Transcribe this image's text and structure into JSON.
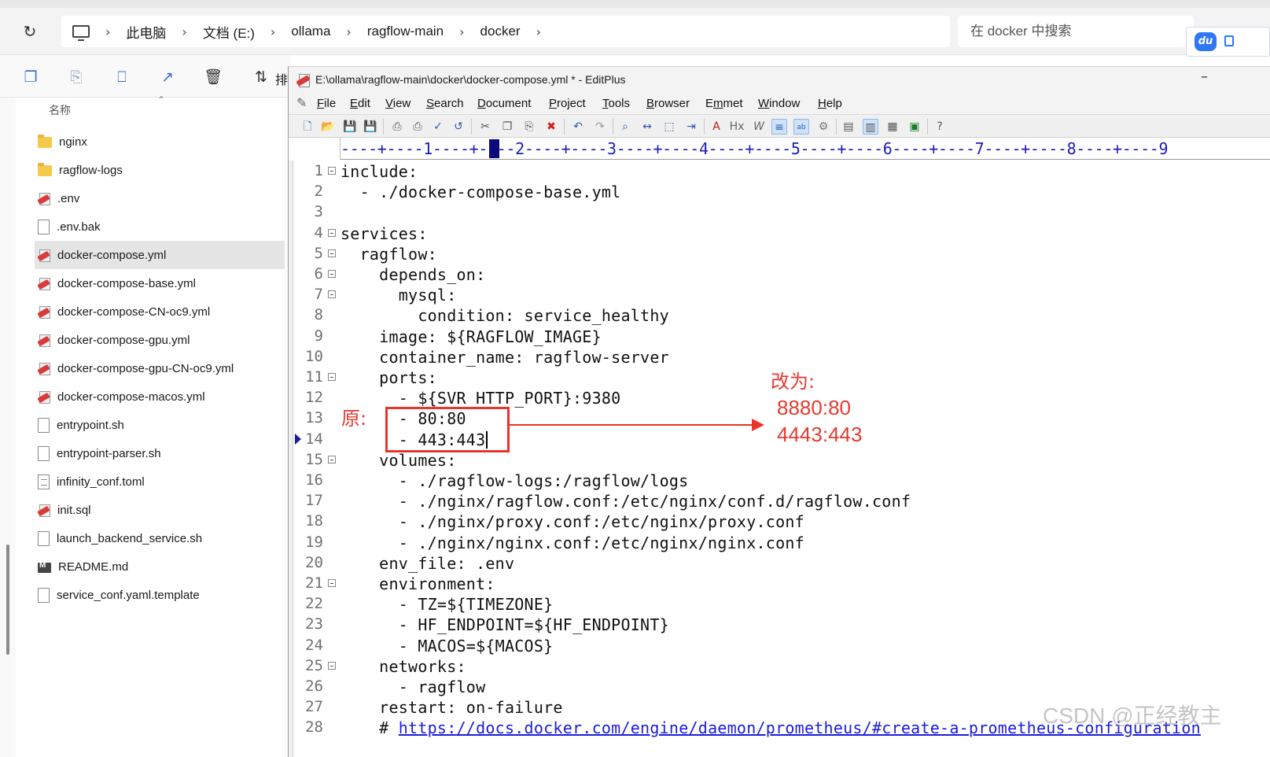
{
  "explorer": {
    "breadcrumb": [
      "此电脑",
      "文档 (E:)",
      "ollama",
      "ragflow-main",
      "docker"
    ],
    "search_placeholder": "在 docker 中搜索",
    "sort_label": "排",
    "column_name": "名称",
    "files": [
      {
        "name": "nginx",
        "icon": "folder-icon",
        "selected": false
      },
      {
        "name": "ragflow-logs",
        "icon": "folder-icon",
        "selected": false
      },
      {
        "name": ".env",
        "icon": "editplus-file-icon",
        "selected": false
      },
      {
        "name": ".env.bak",
        "icon": "generic-file-icon",
        "selected": false
      },
      {
        "name": "docker-compose.yml",
        "icon": "editplus-file-icon",
        "selected": true
      },
      {
        "name": "docker-compose-base.yml",
        "icon": "editplus-file-icon",
        "selected": false
      },
      {
        "name": "docker-compose-CN-oc9.yml",
        "icon": "editplus-file-icon",
        "selected": false
      },
      {
        "name": "docker-compose-gpu.yml",
        "icon": "editplus-file-icon",
        "selected": false
      },
      {
        "name": "docker-compose-gpu-CN-oc9.yml",
        "icon": "editplus-file-icon",
        "selected": false
      },
      {
        "name": "docker-compose-macos.yml",
        "icon": "editplus-file-icon",
        "selected": false
      },
      {
        "name": "entrypoint.sh",
        "icon": "generic-file-icon",
        "selected": false
      },
      {
        "name": "entrypoint-parser.sh",
        "icon": "generic-file-icon",
        "selected": false
      },
      {
        "name": "infinity_conf.toml",
        "icon": "text-file-icon",
        "selected": false
      },
      {
        "name": "init.sql",
        "icon": "editplus-file-icon",
        "selected": false
      },
      {
        "name": "launch_backend_service.sh",
        "icon": "generic-file-icon",
        "selected": false
      },
      {
        "name": "README.md",
        "icon": "markdown-file-icon",
        "selected": false
      },
      {
        "name": "service_conf.yaml.template",
        "icon": "generic-file-icon",
        "selected": false
      }
    ]
  },
  "editplus": {
    "title": "E:\\ollama\\ragflow-main\\docker\\docker-compose.yml * - EditPlus",
    "menu": [
      {
        "label": "File",
        "u": "F",
        "rest": "ile"
      },
      {
        "label": "Edit",
        "u": "E",
        "rest": "dit"
      },
      {
        "label": "View",
        "u": "V",
        "rest": "iew"
      },
      {
        "label": "Search",
        "u": "S",
        "rest": "earch"
      },
      {
        "label": "Document",
        "u": "D",
        "rest": "ocument"
      },
      {
        "label": "Project",
        "u": "P",
        "rest": "roject"
      },
      {
        "label": "Tools",
        "u": "T",
        "rest": "ools"
      },
      {
        "label": "Browser",
        "u": "B",
        "rest": "rowser"
      },
      {
        "label": "Emmet",
        "u": "m",
        "pre": "E",
        "rest": "met"
      },
      {
        "label": "Window",
        "u": "W",
        "rest": "indow"
      },
      {
        "label": "Help",
        "u": "H",
        "rest": "elp"
      }
    ],
    "ruler": "----+----1----+----2----+----3----+----4----+----5----+----6----+----7----+----8----+----9",
    "lines": [
      {
        "n": "1",
        "fold": true,
        "text": "include:"
      },
      {
        "n": "2",
        "fold": false,
        "text": "  - ./docker-compose-base.yml"
      },
      {
        "n": "3",
        "fold": false,
        "text": ""
      },
      {
        "n": "4",
        "fold": true,
        "text": "services:"
      },
      {
        "n": "5",
        "fold": true,
        "text": "  ragflow:"
      },
      {
        "n": "6",
        "fold": true,
        "text": "    depends_on:"
      },
      {
        "n": "7",
        "fold": true,
        "text": "      mysql:"
      },
      {
        "n": "8",
        "fold": false,
        "text": "        condition: service_healthy"
      },
      {
        "n": "9",
        "fold": false,
        "text": "    image: ${RAGFLOW_IMAGE}"
      },
      {
        "n": "10",
        "fold": false,
        "text": "    container_name: ragflow-server"
      },
      {
        "n": "11",
        "fold": true,
        "text": "    ports:"
      },
      {
        "n": "12",
        "fold": false,
        "text": "      - ${SVR_HTTP_PORT}:9380"
      },
      {
        "n": "13",
        "fold": false,
        "text": "      - 80:80"
      },
      {
        "n": "14",
        "fold": false,
        "text": "      - 443:443",
        "caret": true
      },
      {
        "n": "15",
        "fold": true,
        "text": "    volumes:"
      },
      {
        "n": "16",
        "fold": false,
        "text": "      - ./ragflow-logs:/ragflow/logs"
      },
      {
        "n": "17",
        "fold": false,
        "text": "      - ./nginx/ragflow.conf:/etc/nginx/conf.d/ragflow.conf"
      },
      {
        "n": "18",
        "fold": false,
        "text": "      - ./nginx/proxy.conf:/etc/nginx/proxy.conf"
      },
      {
        "n": "19",
        "fold": false,
        "text": "      - ./nginx/nginx.conf:/etc/nginx/nginx.conf"
      },
      {
        "n": "20",
        "fold": false,
        "text": "    env_file: .env"
      },
      {
        "n": "21",
        "fold": true,
        "text": "    environment:"
      },
      {
        "n": "22",
        "fold": false,
        "text": "      - TZ=${TIMEZONE}"
      },
      {
        "n": "23",
        "fold": false,
        "text": "      - HF_ENDPOINT=${HF_ENDPOINT}"
      },
      {
        "n": "24",
        "fold": false,
        "text": "      - MACOS=${MACOS}"
      },
      {
        "n": "25",
        "fold": true,
        "text": "    networks:"
      },
      {
        "n": "26",
        "fold": false,
        "text": "      - ragflow"
      },
      {
        "n": "27",
        "fold": false,
        "text": "    restart: on-failure"
      },
      {
        "n": "28",
        "fold": false,
        "text": "    # ",
        "link": "https://docs.docker.com/engine/daemon/prometheus/#create-a-prometheus-configuration"
      }
    ]
  },
  "annotation": {
    "original_label": "原:",
    "change_label": "改为:",
    "new_value_1": "8880:80",
    "new_value_2": "4443:443",
    "color": "#e8342c"
  },
  "watermark": "CSDN @正经教主"
}
